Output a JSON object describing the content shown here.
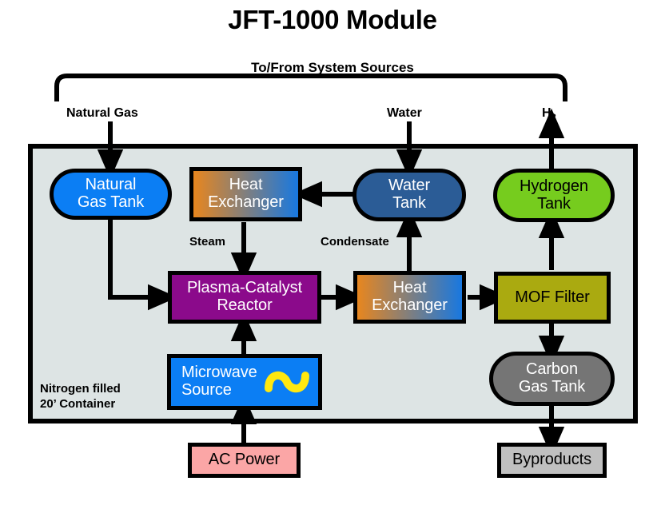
{
  "title": "JFT-1000 Module",
  "bracket": {
    "label": "To/From System Sources"
  },
  "io_labels": {
    "natural_gas": "Natural Gas",
    "water": "Water",
    "hydrogen": "H",
    "hydrogen_sub": "2"
  },
  "container": {
    "label": "Nitrogen filled\n20’ Container",
    "fill": "#dde4e4",
    "stroke": "#000000"
  },
  "flow_labels": {
    "steam": "Steam",
    "condensate": "Condensate"
  },
  "nodes": {
    "natural_gas_tank": {
      "label": "Natural\nGas Tank",
      "fill": "#0b7ef4",
      "text": "#ffffff",
      "shape": "rounded"
    },
    "heat_exchanger_top": {
      "label": "Heat\nExchanger",
      "fill_from": "#e8861e",
      "fill_to": "#1878e0",
      "text": "#ffffff",
      "shape": "rect"
    },
    "water_tank": {
      "label": "Water\nTank",
      "fill": "#2b5c96",
      "text": "#ffffff",
      "shape": "rounded"
    },
    "hydrogen_tank": {
      "label": "Hydrogen\nTank",
      "fill": "#76cc1e",
      "text": "#000000",
      "shape": "rounded"
    },
    "plasma_catalyst_reactor": {
      "label": "Plasma-Catalyst\nReactor",
      "fill": "#8b0a8b",
      "text": "#ffffff",
      "shape": "rect"
    },
    "heat_exchanger_bottom": {
      "label": "Heat\nExchanger",
      "fill_from": "#e8861e",
      "fill_to": "#1878e0",
      "text": "#ffffff",
      "shape": "rect"
    },
    "mof_filter": {
      "label": "MOF Filter",
      "fill": "#aaaa10",
      "text": "#000000",
      "shape": "rect"
    },
    "microwave_source": {
      "label": "Microwave\nSource",
      "fill": "#0b7ef4",
      "text": "#ffffff",
      "shape": "rect",
      "icon": "sine-wave-icon",
      "icon_color": "#ffe810"
    },
    "carbon_gas_tank": {
      "label": "Carbon\nGas Tank",
      "fill": "#757575",
      "text": "#ffffff",
      "shape": "rounded"
    },
    "ac_power": {
      "label": "AC Power",
      "fill": "#fba6a6",
      "text": "#000000",
      "shape": "rect"
    },
    "byproducts": {
      "label": "Byproducts",
      "fill": "#c0c0c0",
      "text": "#000000",
      "shape": "rect"
    }
  },
  "chart_data": {
    "type": "diagram",
    "title": "JFT-1000 Module",
    "subtitle": "To/From System Sources",
    "boundary": "Nitrogen filled 20’ Container",
    "inputs": [
      "Natural Gas",
      "Water"
    ],
    "outputs": [
      "H2",
      "Byproducts"
    ],
    "external": [
      "AC Power"
    ],
    "blocks": [
      "Natural Gas Tank",
      "Heat Exchanger",
      "Water Tank",
      "Hydrogen Tank",
      "Plasma-Catalyst Reactor",
      "Heat Exchanger",
      "MOF Filter",
      "Microwave Source",
      "Carbon Gas Tank",
      "AC Power",
      "Byproducts"
    ],
    "edges": [
      {
        "from": "Natural Gas",
        "to": "Natural Gas Tank",
        "label": ""
      },
      {
        "from": "Natural Gas Tank",
        "to": "Plasma-Catalyst Reactor",
        "label": ""
      },
      {
        "from": "Water",
        "to": "Water Tank",
        "label": ""
      },
      {
        "from": "Water Tank",
        "to": "Heat Exchanger (top)",
        "label": ""
      },
      {
        "from": "Heat Exchanger (top)",
        "to": "Plasma-Catalyst Reactor",
        "label": "Steam"
      },
      {
        "from": "Plasma-Catalyst Reactor",
        "to": "Heat Exchanger (bottom)",
        "label": ""
      },
      {
        "from": "Heat Exchanger (bottom)",
        "to": "Water Tank",
        "label": "Condensate"
      },
      {
        "from": "Heat Exchanger (bottom)",
        "to": "MOF Filter",
        "label": ""
      },
      {
        "from": "MOF Filter",
        "to": "Hydrogen Tank",
        "label": ""
      },
      {
        "from": "MOF Filter",
        "to": "Carbon Gas Tank",
        "label": ""
      },
      {
        "from": "Hydrogen Tank",
        "to": "H2",
        "label": ""
      },
      {
        "from": "Carbon Gas Tank",
        "to": "Byproducts",
        "label": ""
      },
      {
        "from": "AC Power",
        "to": "Microwave Source",
        "label": ""
      },
      {
        "from": "Microwave Source",
        "to": "Plasma-Catalyst Reactor",
        "label": ""
      }
    ]
  }
}
